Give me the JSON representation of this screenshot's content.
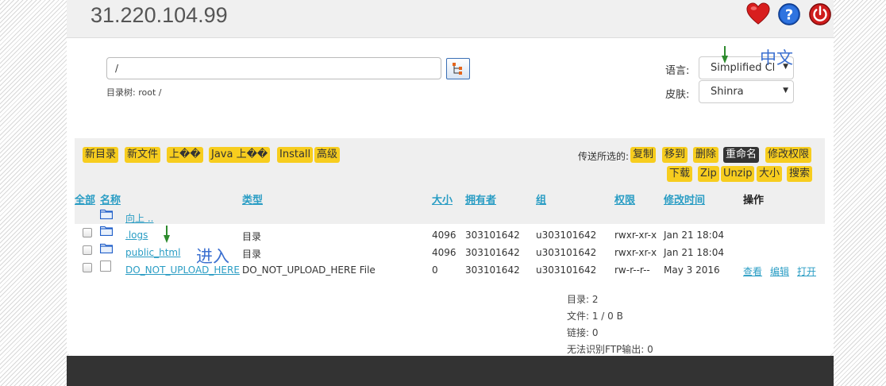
{
  "header": {
    "host": "31.220.104.99"
  },
  "path": {
    "value": "/",
    "tree_label": "目录树: root /"
  },
  "options": {
    "language_label": "语言:",
    "language_value": "Simplified Cl",
    "skin_label": "皮肤:",
    "skin_value": "Shinra",
    "dropdown_arrow": "▼"
  },
  "toolbar": {
    "left_buttons": [
      "新目录",
      "新文件",
      "上��",
      "Java 上��",
      "Install",
      "高级"
    ],
    "move_label": "传送所选的:",
    "right_row1": [
      "复制",
      "移到",
      "删除",
      "重命名",
      "修改权限"
    ],
    "right_row2": [
      "下载",
      "Zip",
      "Unzip",
      "大小",
      "搜索"
    ]
  },
  "table": {
    "headers": {
      "all": "全部",
      "name": "名称",
      "type": "类型",
      "size": "大小",
      "owner": "拥有者",
      "group": "组",
      "perms": "权限",
      "mtime": "修改时间",
      "actions": "操作"
    },
    "up_label": "向上 ..",
    "rows": [
      {
        "name": ".logs",
        "type": "目录",
        "size": "4096",
        "owner": "303101642",
        "group": "u303101642",
        "perms": "rwxr-xr-x",
        "mtime": "Jan 21 18:04"
      },
      {
        "name": "public_html",
        "type": "目录",
        "size": "4096",
        "owner": "303101642",
        "group": "u303101642",
        "perms": "rwxr-xr-x",
        "mtime": "Jan 21 18:04"
      },
      {
        "name": "DO_NOT_UPLOAD_HERE",
        "type": "DO_NOT_UPLOAD_HERE File",
        "size": "0",
        "owner": "303101642",
        "group": "u303101642",
        "perms": "rw-r--r--",
        "mtime": "May 3 2016",
        "actions": [
          "查看",
          "编辑",
          "打开"
        ]
      }
    ]
  },
  "stats": {
    "dirs": "目录: 2",
    "files": "文件: 1 / 0 B",
    "links": "链接: 0",
    "unknown": "无法识别FTP输出: 0"
  },
  "annotations": {
    "chinese": "中文",
    "enter": "进入"
  },
  "icons": {
    "favorite": "heart-icon",
    "help": "help-icon",
    "logout": "power-icon",
    "tree": "tree-icon",
    "folder": "folder-icon",
    "file": "file-icon"
  },
  "colors": {
    "button_yellow": "#f7cd1e",
    "button_dark": "#333333",
    "link_blue": "#2a9dc4",
    "annotation_blue": "#3a6fd0",
    "arrow_green": "#2e8b2e",
    "footer": "#333333"
  }
}
